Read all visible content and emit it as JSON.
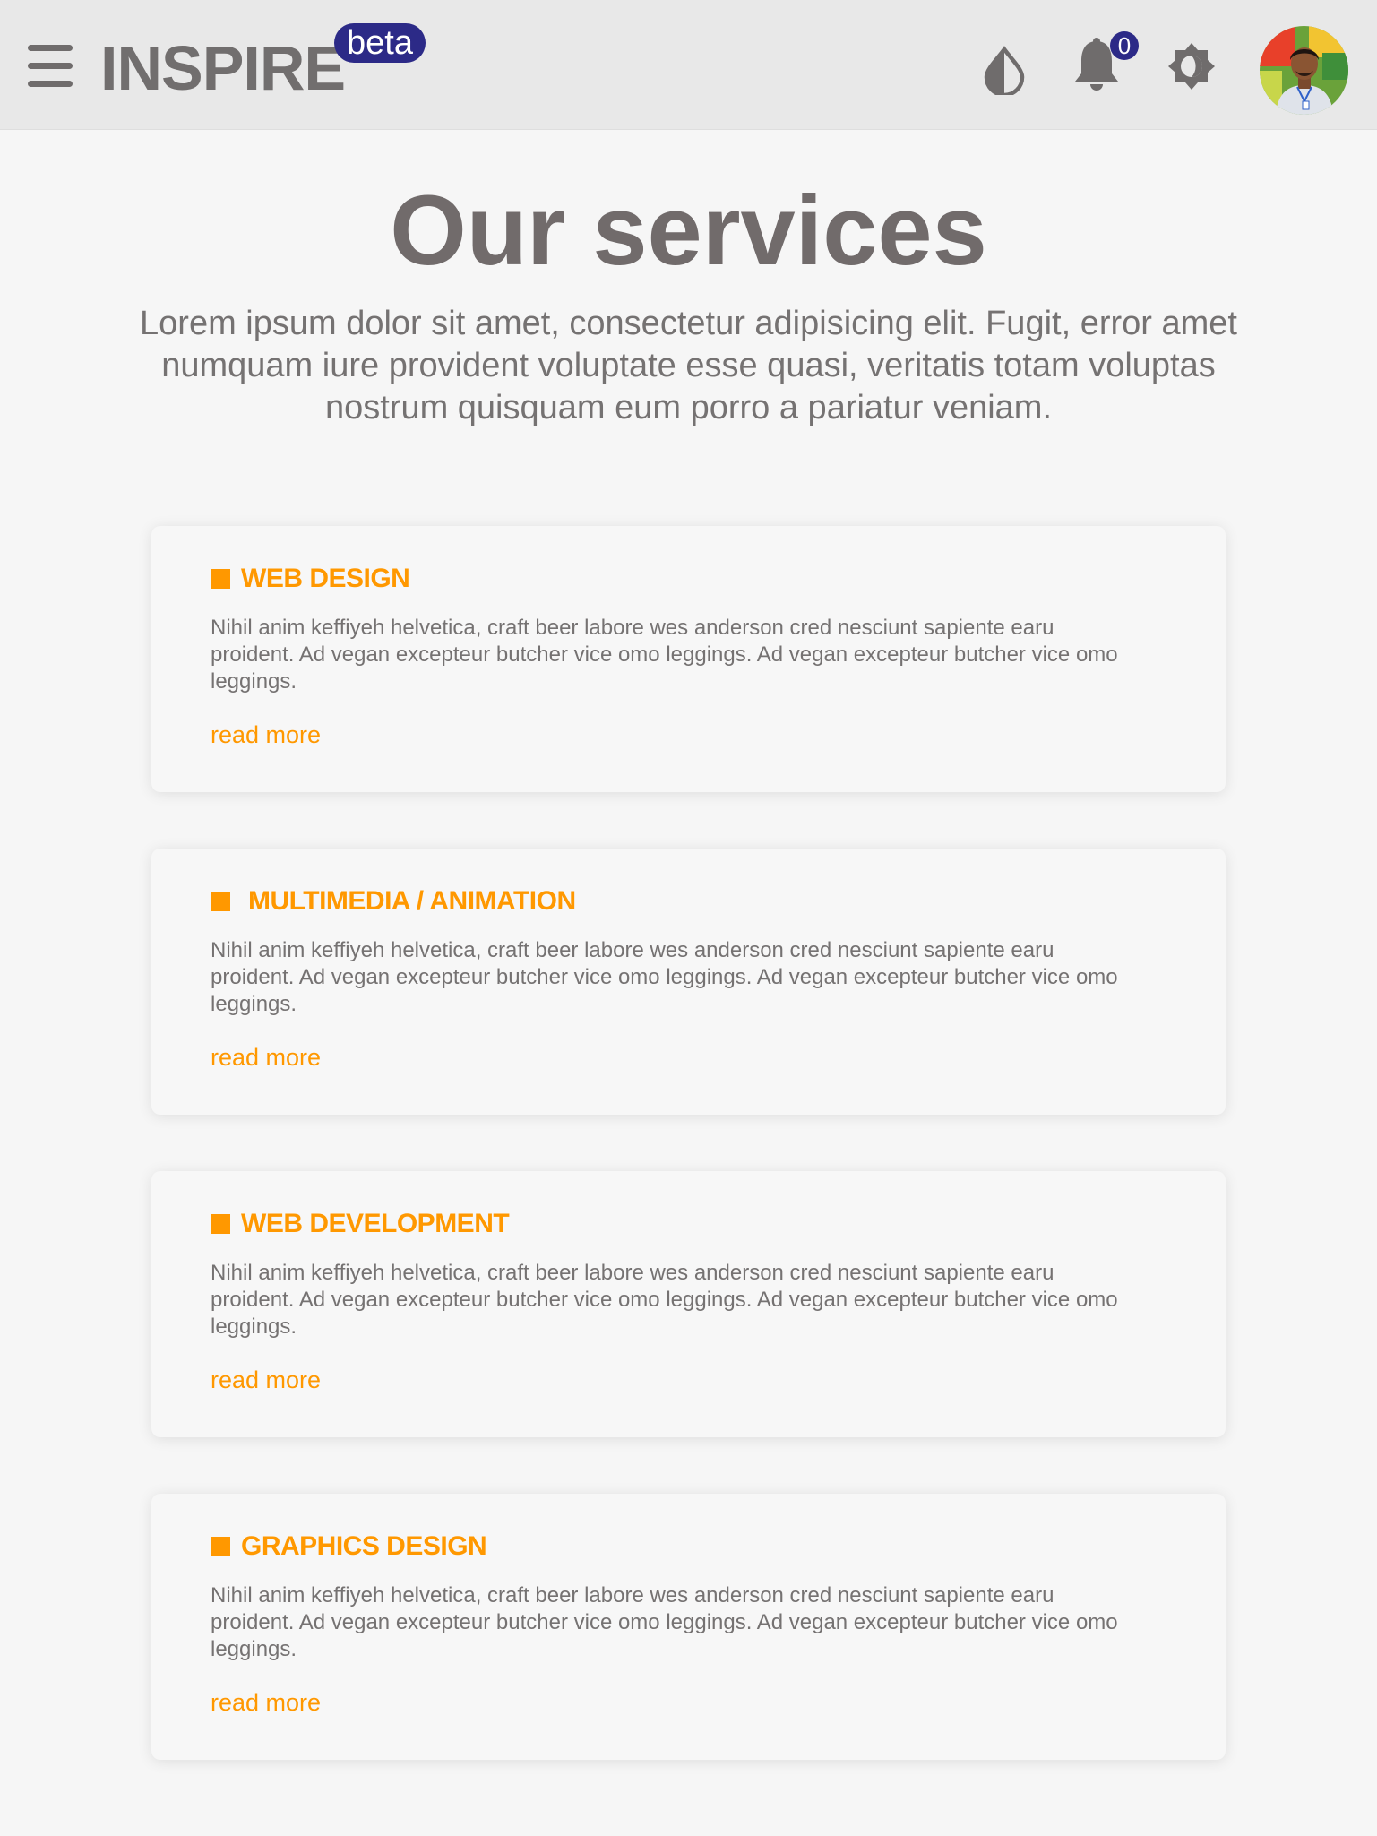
{
  "header": {
    "brand": "INSPIRE",
    "badge": "beta",
    "notification_count": "0",
    "icons": [
      "menu-icon",
      "contrast-icon",
      "bell-icon",
      "brightness-icon",
      "avatar"
    ]
  },
  "main": {
    "title": "Our services",
    "intro": "Lorem ipsum dolor sit amet, consectetur adipisicing elit. Fugit, error amet numquam iure provident voluptate esse quasi, veritatis totam voluptas nostrum quisquam eum porro a pariatur veniam."
  },
  "services": [
    {
      "title": "WEB DESIGN",
      "body": "Nihil anim keffiyeh helvetica, craft beer labore wes anderson cred nesciunt sapiente earu proident. Ad vegan excepteur butcher vice omo leggings. Ad vegan excepteur butcher vice omo leggings.",
      "link": "read more"
    },
    {
      "title": "MULTIMEDIA / ANIMATION",
      "body": "Nihil anim keffiyeh helvetica, craft beer labore wes anderson cred nesciunt sapiente earu proident. Ad vegan excepteur butcher vice omo leggings. Ad vegan excepteur butcher vice omo leggings.",
      "link": "read more"
    },
    {
      "title": "WEB DEVELOPMENT",
      "body": "Nihil anim keffiyeh helvetica, craft beer labore wes anderson cred nesciunt sapiente earu proident. Ad vegan excepteur butcher vice omo leggings. Ad vegan excepteur butcher vice omo leggings.",
      "link": "read more"
    },
    {
      "title": "GRAPHICS DESIGN",
      "body": "Nihil anim keffiyeh helvetica, craft beer labore wes anderson cred nesciunt sapiente earu proident. Ad vegan excepteur butcher vice omo leggings. Ad vegan excepteur butcher vice omo leggings.",
      "link": "read more"
    }
  ],
  "colors": {
    "accent": "#ff9800",
    "badge": "#2c2a87",
    "text": "#757272",
    "header_bg": "#e8e8e8",
    "page_bg": "#f6f6f6"
  }
}
